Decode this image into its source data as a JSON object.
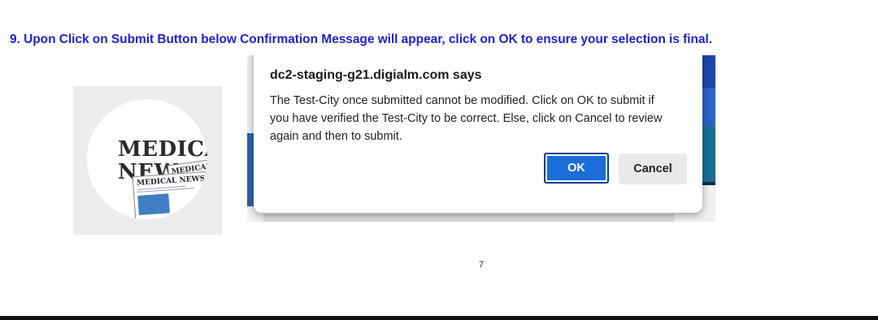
{
  "instruction": {
    "text": "9.  Upon Click on Submit Button below Confirmation Message will appear, click on OK to ensure your selection is final."
  },
  "logo": {
    "line1": "MEDICAL",
    "line2": "NEWS",
    "paper_title": "MEDICAL NEWS",
    "paper_title_partial": "MEDICAL NE"
  },
  "dialog": {
    "title": "dc2-staging-g21.digialm.com says",
    "message": "The Test-City once submitted cannot be modified. Click on OK to submit if you have verified the Test-City to be correct. Else, click on Cancel to review again and then to submit.",
    "ok_label": "OK",
    "cancel_label": "Cancel"
  },
  "page_number": "7",
  "colors": {
    "instruction_text": "#1f23c8",
    "ok_button": "#1a6ed8",
    "cancel_button": "#e9e9e9"
  }
}
